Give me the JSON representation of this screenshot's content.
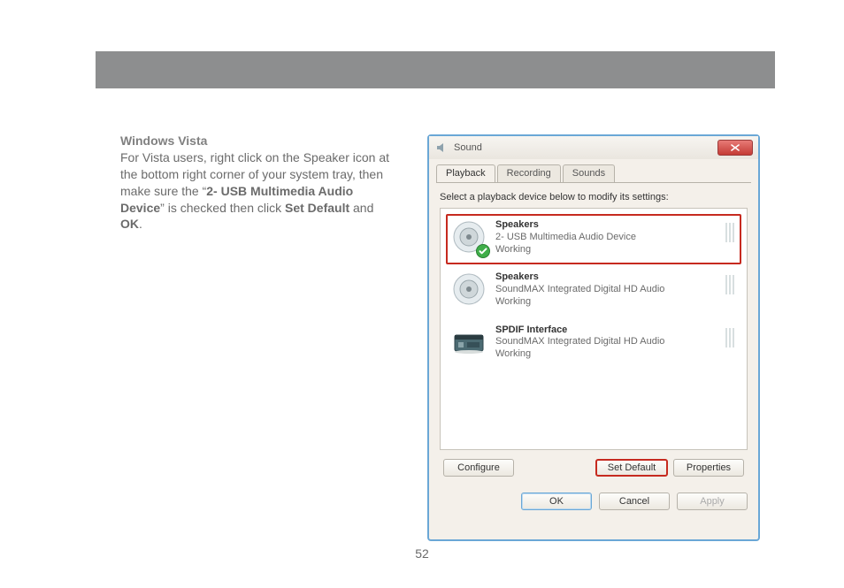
{
  "page_number": "52",
  "article": {
    "heading": "Windows Vista",
    "para_part1": "For Vista users, right click on the Speaker icon at the bottom right corner of your system tray, then make sure the “",
    "bold1": "2- USB Multimedia Audio Device",
    "para_part2": "” is checked then click ",
    "bold2": "Set Default",
    "para_part3": " and ",
    "bold3": "OK",
    "para_part4": "."
  },
  "dialog": {
    "title": "Sound",
    "tabs": {
      "t0": "Playback",
      "t1": "Recording",
      "t2": "Sounds"
    },
    "hint": "Select a playback device below to modify its settings:",
    "devices": [
      {
        "title": "Speakers",
        "subtitle": "2- USB Multimedia Audio Device",
        "status": "Working",
        "icon": "speaker",
        "selected": true,
        "checked": true
      },
      {
        "title": "Speakers",
        "subtitle": "SoundMAX Integrated Digital HD Audio",
        "status": "Working",
        "icon": "speaker",
        "selected": false,
        "checked": false
      },
      {
        "title": "SPDIF Interface",
        "subtitle": "SoundMAX Integrated Digital HD Audio",
        "status": "Working",
        "icon": "spdif",
        "selected": false,
        "checked": false
      }
    ],
    "buttons": {
      "configure": "Configure",
      "set_default": "Set Default",
      "properties": "Properties",
      "ok": "OK",
      "cancel": "Cancel",
      "apply": "Apply"
    }
  }
}
